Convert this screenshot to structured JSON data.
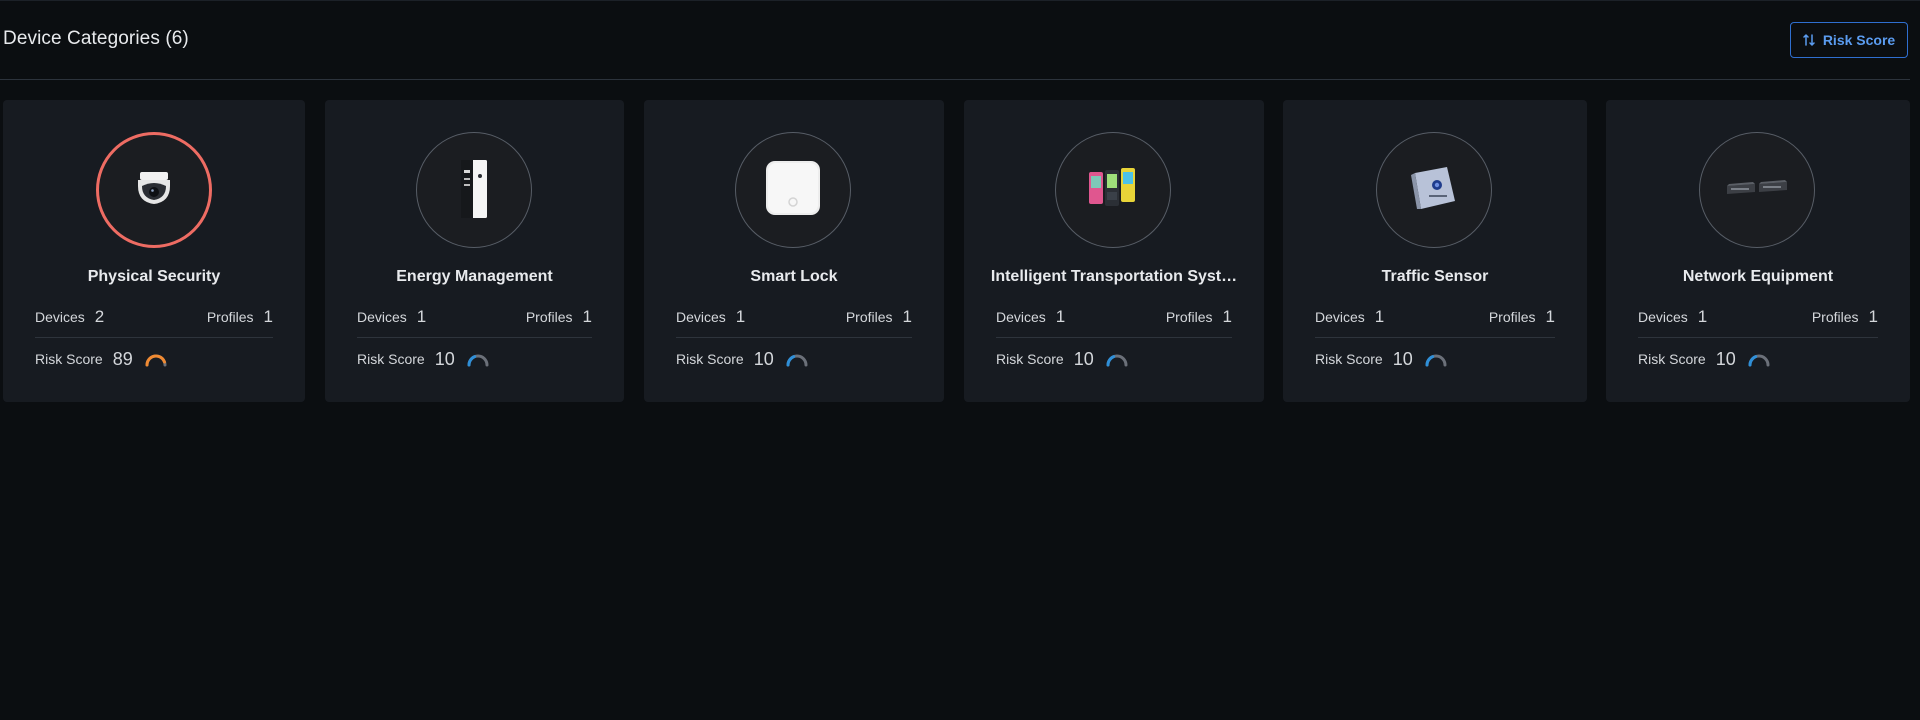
{
  "header": {
    "title": "Device Categories (6)",
    "sort_label": "Risk Score",
    "sort_icon": "sort-arrows-icon"
  },
  "colors": {
    "background": "#0b0e11",
    "card": "#171b21",
    "accent": "#5b9cf0",
    "alert_ring": "#ee6c63",
    "gauge_high": "#f08a32",
    "gauge_low": "#2e8fd8",
    "gauge_track": "#6b7079"
  },
  "cards": [
    {
      "title": "Physical Security",
      "devices_label": "Devices",
      "devices": "2",
      "profiles_label": "Profiles",
      "profiles": "1",
      "risk_label": "Risk Score",
      "risk": "89",
      "risk_fraction": 0.89,
      "icon": "dome-camera-icon",
      "alert": true
    },
    {
      "title": "Energy Management",
      "devices_label": "Devices",
      "devices": "1",
      "profiles_label": "Profiles",
      "profiles": "1",
      "risk_label": "Risk Score",
      "risk": "10",
      "risk_fraction": 0.1,
      "icon": "ev-charger-icon",
      "alert": false
    },
    {
      "title": "Smart Lock",
      "devices_label": "Devices",
      "devices": "1",
      "profiles_label": "Profiles",
      "profiles": "1",
      "risk_label": "Risk Score",
      "risk": "10",
      "risk_fraction": 0.1,
      "icon": "smart-lock-icon",
      "alert": false
    },
    {
      "title": "Intelligent Transportation Syst…",
      "devices_label": "Devices",
      "devices": "1",
      "profiles_label": "Profiles",
      "profiles": "1",
      "risk_label": "Risk Score",
      "risk": "10",
      "risk_fraction": 0.1,
      "icon": "card-readers-icon",
      "alert": false
    },
    {
      "title": "Traffic Sensor",
      "devices_label": "Devices",
      "devices": "1",
      "profiles_label": "Profiles",
      "profiles": "1",
      "risk_label": "Risk Score",
      "risk": "10",
      "risk_fraction": 0.1,
      "icon": "traffic-sensor-icon",
      "alert": false
    },
    {
      "title": "Network Equipment",
      "devices_label": "Devices",
      "devices": "1",
      "profiles_label": "Profiles",
      "profiles": "1",
      "risk_label": "Risk Score",
      "risk": "10",
      "risk_fraction": 0.1,
      "icon": "network-switch-icon",
      "alert": false
    }
  ]
}
